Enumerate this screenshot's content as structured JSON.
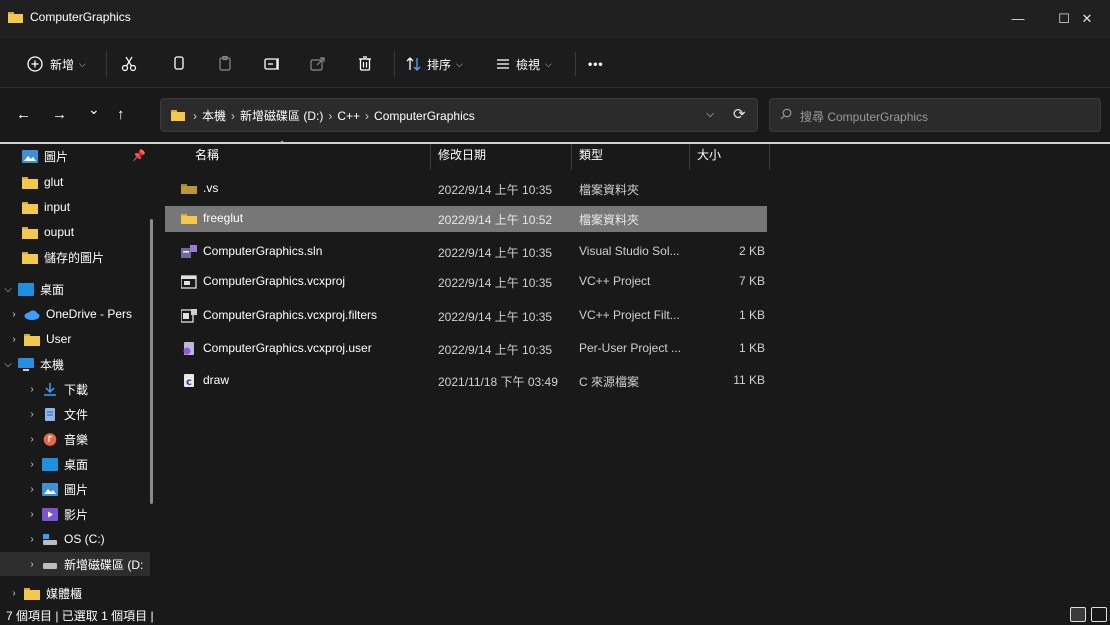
{
  "window": {
    "title": "ComputerGraphics",
    "minimize_glyph": "—",
    "maximize_glyph": "☐",
    "close_glyph": "✕"
  },
  "toolbar": {
    "new_label": "新增",
    "sort_label": "排序",
    "view_label": "檢視",
    "more_label": "•••"
  },
  "navigation": {
    "back_glyph": "←",
    "forward_glyph": "→",
    "recent_glyph": "⌄",
    "up_glyph": "↑"
  },
  "address": {
    "crumbs": [
      "本機",
      "新增磁碟區 (D:)",
      "C++",
      "ComputerGraphics"
    ],
    "separator": "›"
  },
  "search": {
    "placeholder": "搜尋 ComputerGraphics"
  },
  "sidebar": {
    "items": [
      {
        "label": "圖片",
        "icon": "pictures-icon"
      },
      {
        "label": "glut",
        "icon": "folder-icon"
      },
      {
        "label": "input",
        "icon": "folder-icon"
      },
      {
        "label": "ouput",
        "icon": "folder-icon"
      },
      {
        "label": "儲存的圖片",
        "icon": "folder-icon"
      },
      {
        "label": "桌面",
        "icon": "desktop-icon"
      },
      {
        "label": "OneDrive - Pers",
        "icon": "onedrive-icon"
      },
      {
        "label": "User",
        "icon": "folder-icon"
      },
      {
        "label": "本機",
        "icon": "this-pc-icon"
      },
      {
        "label": "下載",
        "icon": "downloads-icon"
      },
      {
        "label": "文件",
        "icon": "documents-icon"
      },
      {
        "label": "音樂",
        "icon": "music-icon"
      },
      {
        "label": "桌面",
        "icon": "desktop-icon"
      },
      {
        "label": "圖片",
        "icon": "pictures-icon"
      },
      {
        "label": "影片",
        "icon": "videos-icon"
      },
      {
        "label": "OS (C:)",
        "icon": "os-drive-icon"
      },
      {
        "label": "新增磁碟區 (D:",
        "icon": "drive-icon"
      },
      {
        "label": "媒體櫃",
        "icon": "library-icon"
      }
    ]
  },
  "columns": {
    "name": "名稱",
    "modified": "修改日期",
    "type": "類型",
    "size": "大小"
  },
  "files": [
    {
      "name": ".vs",
      "modified": "2022/9/14 上午 10:35",
      "type": "檔案資料夾",
      "size": "",
      "icon": "folder-dark-icon"
    },
    {
      "name": "freeglut",
      "modified": "2022/9/14 上午 10:52",
      "type": "檔案資料夾",
      "size": "",
      "icon": "folder-icon"
    },
    {
      "name": "ComputerGraphics.sln",
      "modified": "2022/9/14 上午 10:35",
      "type": "Visual Studio Sol...",
      "size": "2 KB",
      "icon": "sln-file-icon"
    },
    {
      "name": "ComputerGraphics.vcxproj",
      "modified": "2022/9/14 上午 10:35",
      "type": "VC++ Project",
      "size": "7 KB",
      "icon": "vcxproj-file-icon"
    },
    {
      "name": "ComputerGraphics.vcxproj.filters",
      "modified": "2022/9/14 上午 10:35",
      "type": "VC++ Project Filt...",
      "size": "1 KB",
      "icon": "filters-file-icon"
    },
    {
      "name": "ComputerGraphics.vcxproj.user",
      "modified": "2022/9/14 上午 10:35",
      "type": "Per-User Project ...",
      "size": "1 KB",
      "icon": "user-file-icon"
    },
    {
      "name": "draw",
      "modified": "2021/11/18 下午 03:49",
      "type": "C 來源檔案",
      "size": "11 KB",
      "icon": "c-file-icon"
    }
  ],
  "status": {
    "text": "7 個項目  |  已選取 1 個項目  |"
  },
  "colors": {
    "folder": "#f2c94c",
    "selection": "#777777",
    "background": "#191919"
  }
}
